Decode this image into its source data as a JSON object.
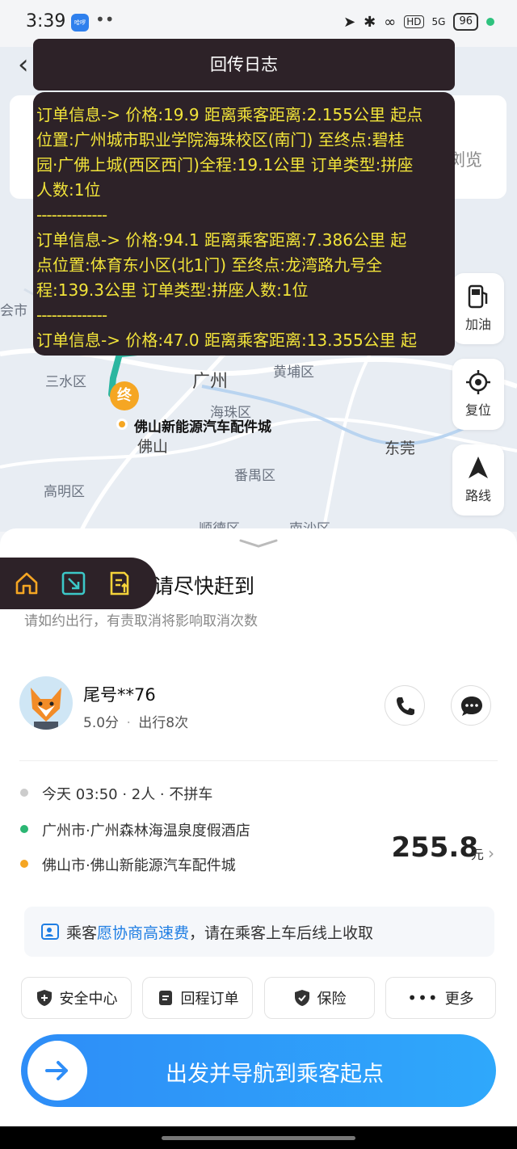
{
  "status_bar": {
    "time": "3:39",
    "app_badge": "哈啰",
    "dots": "••",
    "net": "HD",
    "signal": "5G",
    "battery": "96"
  },
  "map": {
    "labels": {
      "city_left": "会市",
      "sanshui": "三水区",
      "guangzhou": "广州",
      "huangpu": "黄埔区",
      "haizhu": "海珠区",
      "destination": "佛山新能源汽车配件城",
      "foshan": "佛山",
      "dongguan": "东莞",
      "panyu": "番禺区",
      "gaoming": "高明区",
      "shunde": "顺德区",
      "nansha": "南沙区"
    },
    "end_marker": "终",
    "bg_card_text": "浏览"
  },
  "log": {
    "title": "回传日志",
    "separator": "--------------",
    "lines": [
      "订单信息-> 价格:19.9 距离乘客距离:2.155公里 起点",
      "位置:广州城市职业学院海珠校区(南门) 至终点:碧桂",
      "园·广佛上城(西区西门)全程:19.1公里 订单类型:拼座",
      "人数:1位",
      "订单信息-> 价格:94.1 距离乘客距离:7.386公里 起",
      "点位置:体育东小区(北1门) 至终点:龙湾路九号全",
      "程:139.3公里 订单类型:拼座人数:1位",
      "订单信息-> 价格:47.0 距离乘客距离:13.355公里 起"
    ]
  },
  "map_buttons": {
    "refuel": "加油",
    "reset": "复位",
    "route": "路线"
  },
  "sheet": {
    "hint_title": "请尽快赶到",
    "hint_sub": "请如约出行，有责取消将影响取消次数",
    "passenger": {
      "name": "尾号**76",
      "rating": "5.0分",
      "sep": "·",
      "trips": "出行8次"
    },
    "trip": {
      "time_line": "今天 03:50 · 2人 · 不拼车",
      "origin": "广州市·广州森林海温泉度假酒店",
      "destination": "佛山市·佛山新能源汽车配件城",
      "price": "255.8",
      "unit": "元"
    },
    "notice": {
      "prefix": "乘客",
      "highlight": "愿协商高速费",
      "suffix": "，请在乘客上车后线上收取"
    },
    "pills": {
      "safety": "安全中心",
      "return": "回程订单",
      "insurance": "保险",
      "more": "更多"
    },
    "go_button": "出发并导航到乘客起点"
  },
  "colors": {
    "accent": "#2e8df7",
    "log_bg": "#2d2228",
    "log_text": "#f2e43a",
    "origin_dot": "#2bb673",
    "dest_dot": "#f5a623"
  }
}
